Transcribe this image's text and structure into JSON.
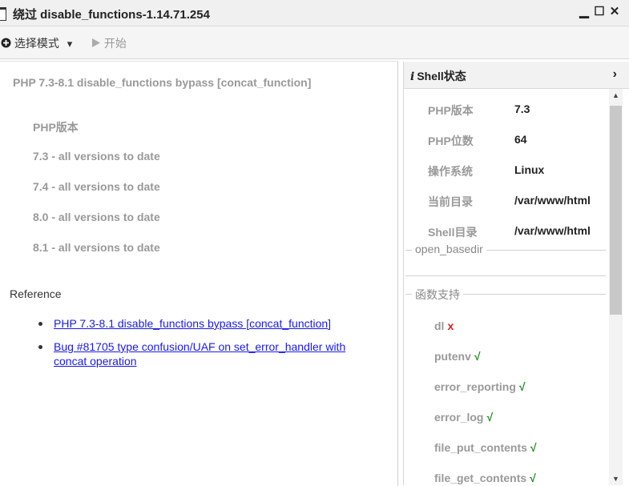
{
  "window": {
    "title": "绕过 disable_functions-1.14.71.254",
    "minimize_glyph": "▁",
    "maximize_glyph": "☐",
    "close_glyph": "✕"
  },
  "toolbar": {
    "mode_icon": "plus-circle-icon",
    "mode_label": "选择模式",
    "mode_caret": "▾",
    "start_label": "开始",
    "start_icon": "play-icon"
  },
  "left": {
    "heading": "PHP 7.3-8.1 disable_functions bypass [concat_function]",
    "versions_title": "PHP版本",
    "versions": [
      "7.3 - all versions to date",
      "7.4 - all versions to date",
      "8.0 - all versions to date",
      "8.1 - all versions to date"
    ],
    "reference_title": "Reference",
    "references": [
      "PHP 7.3-8.1 disable_functions bypass [concat_function]",
      "Bug #81705 type confusion/UAF on set_error_handler with concat operation"
    ]
  },
  "shell_status": {
    "title": "Shell状态",
    "info_icon": "info-icon",
    "collapse_icon": "chevron-right-icon",
    "info": [
      {
        "label": "PHP版本",
        "value": "7.3"
      },
      {
        "label": "PHP位数",
        "value": "64"
      },
      {
        "label": "操作系统",
        "value": "Linux"
      },
      {
        "label": "当前目录",
        "value": "/var/www/html"
      },
      {
        "label": "Shell目录",
        "value": "/var/www/html"
      }
    ],
    "open_basedir_legend": "open_basedir",
    "functions_legend": "函数支持",
    "functions": [
      {
        "name": "dl",
        "supported": false
      },
      {
        "name": "putenv",
        "supported": true
      },
      {
        "name": "error_reporting",
        "supported": true
      },
      {
        "name": "error_log",
        "supported": true
      },
      {
        "name": "file_put_contents",
        "supported": true
      },
      {
        "name": "file_get_contents",
        "supported": true
      }
    ],
    "mark_ok": "√",
    "mark_no": "x"
  }
}
